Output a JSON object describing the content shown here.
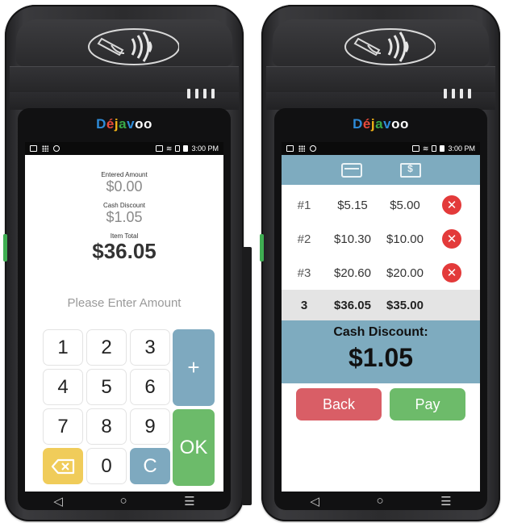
{
  "brand": {
    "name": "Dejavoo"
  },
  "status_bar": {
    "time": "3:00 PM"
  },
  "left_screen": {
    "entered_amount_label": "Entered Amount",
    "entered_amount_value": "$0.00",
    "cash_discount_label": "Cash Discount",
    "cash_discount_value": "$1.05",
    "item_total_label": "Item Total",
    "item_total_value": "$36.05",
    "prompt": "Please Enter Amount",
    "keys": {
      "k1": "1",
      "k2": "2",
      "k3": "3",
      "plus": "+",
      "k4": "4",
      "k5": "5",
      "k6": "6",
      "k7": "7",
      "k8": "8",
      "k9": "9",
      "ok": "OK",
      "k0": "0",
      "clear": "C"
    }
  },
  "right_screen": {
    "tabs": [
      {
        "icon": "credit-card-icon"
      },
      {
        "icon": "cash-icon"
      }
    ],
    "items": [
      {
        "index": "#1",
        "card_price": "$5.15",
        "cash_price": "$5.00"
      },
      {
        "index": "#2",
        "card_price": "$10.30",
        "cash_price": "$10.00"
      },
      {
        "index": "#3",
        "card_price": "$20.60",
        "cash_price": "$20.00"
      }
    ],
    "summary": {
      "count": "3",
      "card_total": "$36.05",
      "cash_total": "$35.00"
    },
    "cash_discount_label": "Cash Discount:",
    "cash_discount_value": "$1.05",
    "back_label": "Back",
    "pay_label": "Pay"
  },
  "colors": {
    "accent_blue": "#7eabbf",
    "ok_green": "#6cbb6a",
    "back_red": "#d95e66",
    "delete_red": "#e33a3a",
    "backspace_yellow": "#f0cc5a"
  },
  "nav": {
    "back": "◁",
    "home": "○",
    "menu": "☰"
  }
}
